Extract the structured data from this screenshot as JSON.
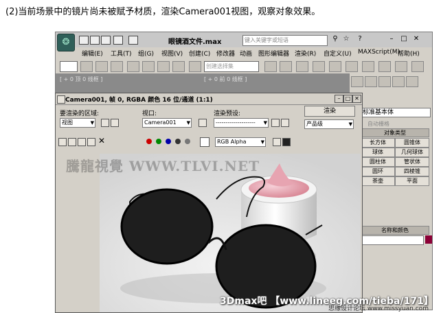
{
  "caption": "(2)当前场景中的镜片尚未被赋予材质，渲染Camera001视图，观察对象效果。",
  "app": {
    "title": "眼镜酒文件.max",
    "search_placeholder": "键入关键字或短语",
    "menu": [
      "编辑(E)",
      "工具(T)",
      "组(G)",
      "视图(V)",
      "创建(C)",
      "修改器",
      "动画",
      "图形编辑器",
      "渲染(R)",
      "自定义(U)",
      "MAXScript(M)",
      "帮助(H)"
    ],
    "selection_set_placeholder": "创建选择集",
    "viewport_labels": [
      "[ + 0 顶 0 线框 ]",
      "[ + 0 前 0 线框 ]"
    ]
  },
  "command_panel": {
    "dropdown": "标准基本体",
    "auto_grid": "自动栅格",
    "object_type_header": "对象类型",
    "objects": [
      "长方体",
      "圆锥体",
      "球体",
      "几何球体",
      "圆柱体",
      "管状体",
      "圆环",
      "四棱锥",
      "茶壶",
      "平面"
    ],
    "name_color_header": "名称和颜色",
    "color_swatch": "#8b0036"
  },
  "render_window": {
    "title": "Camera001, 帧 0, RGBA 颜色 16 位/通道 (1:1)",
    "area_label": "要渲染的区域:",
    "area_value": "视图",
    "viewport_label": "视口:",
    "viewport_value": "Camera001",
    "preset_label": "渲染预设:",
    "preset_value": "--------------------",
    "render_button": "渲染",
    "quality_value": "产品级",
    "channel_value": "RGB Alpha"
  },
  "watermarks": {
    "site": "騰龍視覺 WWW.TLVI.NET",
    "bottom": "3Dmax吧 【www.lineeg.com/tieba/171】",
    "bottom2": "思缘设计论坛 www.missyuan.com"
  }
}
